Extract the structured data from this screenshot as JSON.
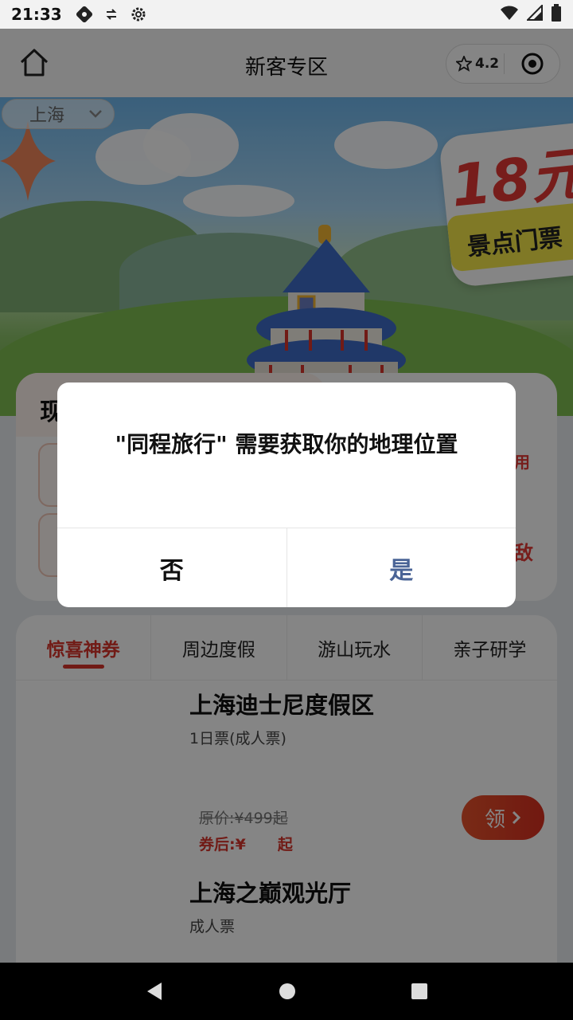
{
  "status_bar": {
    "time": "21:33",
    "left_icons": [
      "debug-icon",
      "data-saver-icon",
      "settings-icon"
    ],
    "right_icons": [
      "wifi-icon",
      "signal-icon",
      "battery-icon"
    ]
  },
  "header": {
    "title": "新客专区",
    "rating": "4.2",
    "icons": [
      "home-icon",
      "star-icon",
      "record-target-icon"
    ]
  },
  "hero": {
    "city": "上海",
    "badge_big": "18元",
    "badge_strip": "景点门票"
  },
  "coupon_card": {
    "title": "现",
    "tag": "用",
    "tag2": "敌"
  },
  "tabs": [
    {
      "label": "惊喜神券",
      "active": true
    },
    {
      "label": "周边度假",
      "active": false
    },
    {
      "label": "游山玩水",
      "active": false
    },
    {
      "label": "亲子研学",
      "active": false
    }
  ],
  "products": [
    {
      "name": "上海迪士尼度假区",
      "subtitle": "1日票(成人票)",
      "original_price": "原价:¥499起",
      "after_coupon_prefix": "券后:¥",
      "after_coupon_suffix": "起",
      "claim_label": "领"
    },
    {
      "name": "上海之巅观光厅",
      "subtitle": "成人票"
    }
  ],
  "dialog": {
    "message": "\"同程旅行\" 需要获取你的地理位置",
    "no_label": "否",
    "yes_label": "是"
  },
  "colors": {
    "accent_red": "#d9342b",
    "dialog_yes": "#4a6496"
  }
}
